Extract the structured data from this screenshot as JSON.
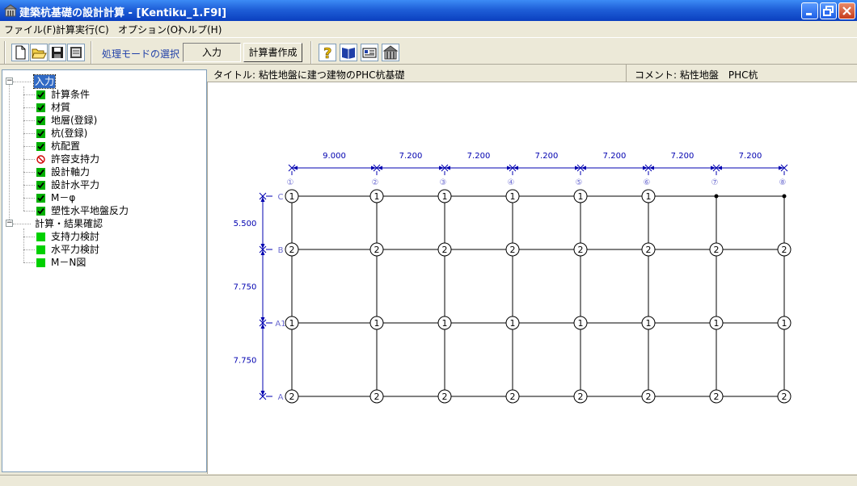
{
  "window": {
    "title": "建築杭基礎の設計計算 - [Kentiku_1.F9I]"
  },
  "window_controls": [
    "minimize-icon",
    "maximize-icon",
    "close-icon"
  ],
  "menu": [
    "ファイル(F)",
    "計算実行(C)",
    "オプション(O)",
    "ヘルプ(H)"
  ],
  "toolbar": {
    "file_buttons": [
      "new-file-icon",
      "open-folder-icon",
      "save-disk-icon",
      "print-preview-icon"
    ],
    "mode_label": "処理モードの選択",
    "mode_value": "入力",
    "report_button": "計算書作成",
    "help_buttons": [
      "question-icon",
      "book-icon",
      "about-icon",
      "building-icon"
    ]
  },
  "tree": {
    "input_group": "入力",
    "input_items": [
      {
        "label": "計算条件",
        "state": "checked"
      },
      {
        "label": "材質",
        "state": "checked"
      },
      {
        "label": "地層(登録)",
        "state": "checked"
      },
      {
        "label": "杭(登録)",
        "state": "checked"
      },
      {
        "label": "杭配置",
        "state": "checked"
      },
      {
        "label": "許容支持力",
        "state": "disabled"
      },
      {
        "label": "設計軸力",
        "state": "checked"
      },
      {
        "label": "設計水平力",
        "state": "checked"
      },
      {
        "label": "M－φ",
        "state": "checked"
      },
      {
        "label": "塑性水平地盤反力",
        "state": "checked"
      }
    ],
    "result_group": "計算・結果確認",
    "result_items": [
      {
        "label": "支持力検討",
        "state": "square"
      },
      {
        "label": "水平力検討",
        "state": "square"
      },
      {
        "label": "M－N図",
        "state": "square"
      }
    ]
  },
  "header": {
    "title": "タイトル: 粘性地盤に建つ建物のPHC杭基礎",
    "comment": "コメント: 粘性地盤　PHC杭"
  },
  "plan": {
    "x_axes": [
      "①",
      "②",
      "③",
      "④",
      "⑤",
      "⑥",
      "⑦",
      "⑧"
    ],
    "x_spans": [
      "9.000",
      "7.200",
      "7.200",
      "7.200",
      "7.200",
      "7.200",
      "7.200"
    ],
    "y_axes": [
      "C",
      "B",
      "A1",
      "A"
    ],
    "y_spans": [
      "5.500",
      "7.750",
      "7.750"
    ],
    "pile_types": [
      [
        "1",
        "1",
        "1",
        "1",
        "1",
        "1",
        "",
        ""
      ],
      [
        "2",
        "2",
        "2",
        "2",
        "2",
        "2",
        "2",
        "2"
      ],
      [
        "1",
        "1",
        "1",
        "1",
        "1",
        "1",
        "1",
        "1"
      ],
      [
        "2",
        "2",
        "2",
        "2",
        "2",
        "2",
        "2",
        "2"
      ]
    ],
    "colors": {
      "dimension": "#0000b0",
      "axis_label": "#6a6ad0",
      "grid": "#000000"
    }
  }
}
